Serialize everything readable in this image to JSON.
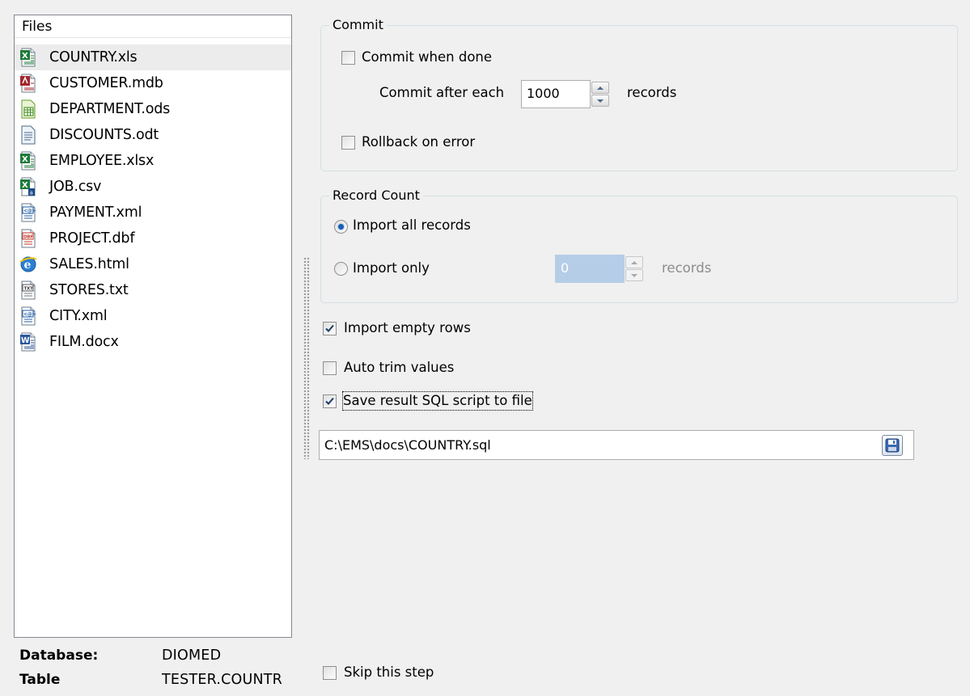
{
  "files_panel": {
    "header": "Files",
    "items": [
      {
        "name": "COUNTRY.xls",
        "icon": "excel-file-icon",
        "selected": true
      },
      {
        "name": "CUSTOMER.mdb",
        "icon": "access-file-icon"
      },
      {
        "name": "DEPARTMENT.ods",
        "icon": "ods-file-icon"
      },
      {
        "name": "DISCOUNTS.odt",
        "icon": "odt-file-icon"
      },
      {
        "name": "EMPLOYEE.xlsx",
        "icon": "excel-file-icon"
      },
      {
        "name": "JOB.csv",
        "icon": "csv-file-icon"
      },
      {
        "name": "PAYMENT.xml",
        "icon": "xml-file-icon"
      },
      {
        "name": "PROJECT.dbf",
        "icon": "dbf-file-icon"
      },
      {
        "name": "SALES.html",
        "icon": "html-file-icon"
      },
      {
        "name": "STORES.txt",
        "icon": "txt-file-icon"
      },
      {
        "name": "CITY.xml",
        "icon": "xml-file-icon"
      },
      {
        "name": "FILM.docx",
        "icon": "word-file-icon"
      }
    ]
  },
  "commit": {
    "title": "Commit",
    "commit_when_done": {
      "label": "Commit when done",
      "checked": false
    },
    "commit_after_each": {
      "label": "Commit after each",
      "value": "1000",
      "suffix": "records"
    },
    "rollback_on_error": {
      "label": "Rollback on error",
      "checked": false
    }
  },
  "record_count": {
    "title": "Record Count",
    "import_all": {
      "label": "Import all records",
      "selected": true
    },
    "import_only": {
      "label": "Import only",
      "selected": false,
      "value": "0",
      "suffix": "records"
    }
  },
  "options": {
    "import_empty_rows": {
      "label": "Import empty rows",
      "checked": true
    },
    "auto_trim_values": {
      "label": "Auto trim values",
      "checked": false
    },
    "save_sql_script": {
      "label": "Save result SQL script to file",
      "checked": true
    }
  },
  "script_path": {
    "value": "C:\\EMS\\docs\\COUNTRY.sql",
    "icon": "save-disk-icon"
  },
  "info": {
    "database_label": "Database:",
    "database_value": "DIOMED",
    "table_label": "Table",
    "table_value": "TESTER.COUNTR"
  },
  "skip_step": {
    "label": "Skip this step",
    "checked": false
  },
  "colors": {
    "selection": "#ececec",
    "disabled_field": "#b6cde8",
    "radio_dot": "#1a5fb4"
  }
}
